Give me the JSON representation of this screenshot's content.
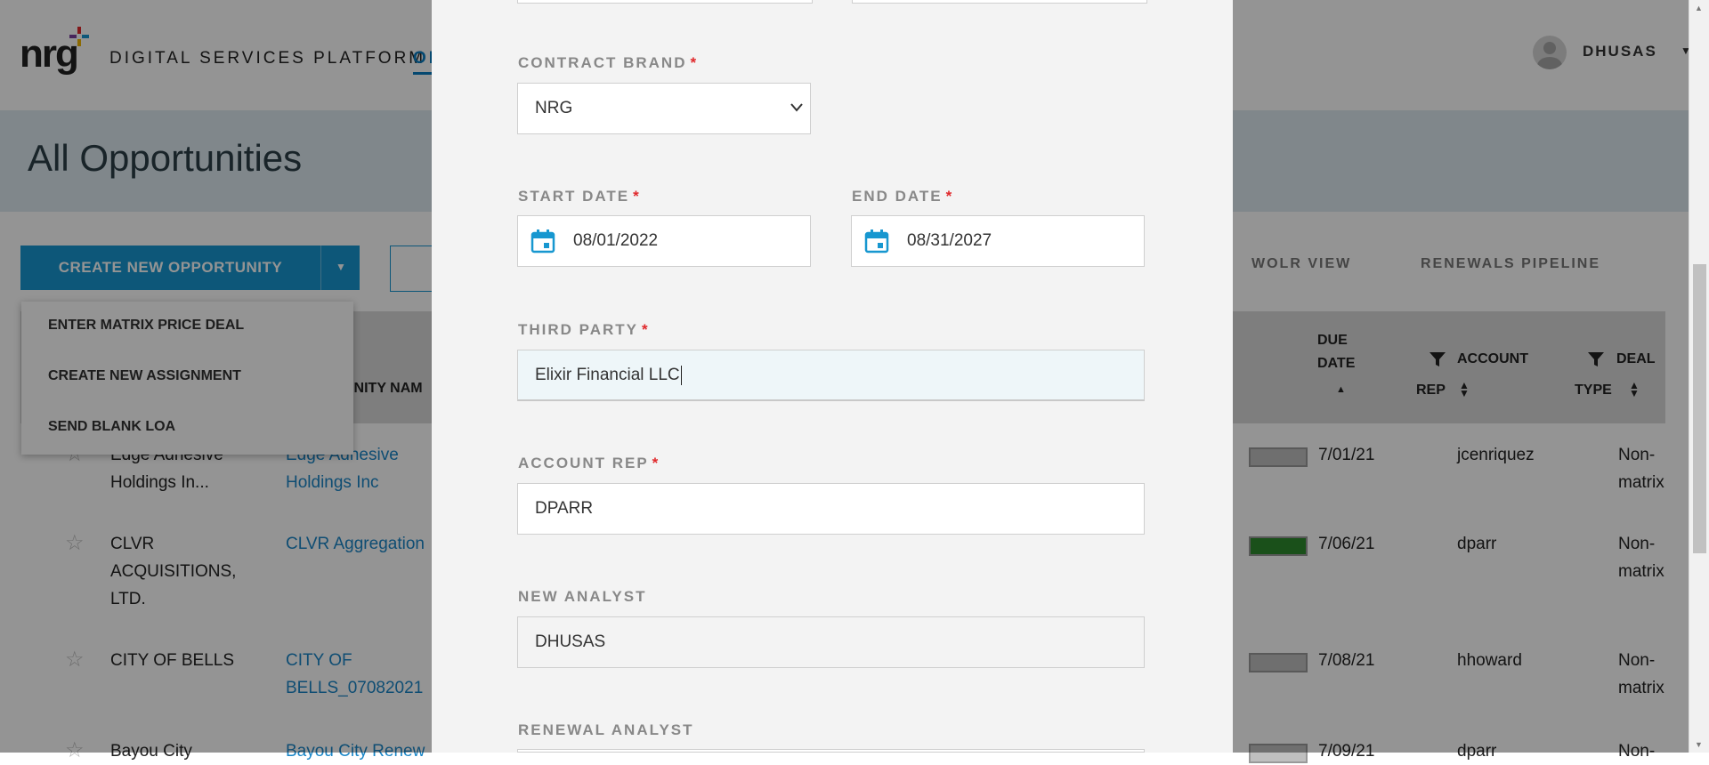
{
  "header": {
    "logo_text": "nrg",
    "platform_title": "DIGITAL SERVICES PLATFORM",
    "nav_tab_partial": "OP",
    "user_name": "DHUSAS"
  },
  "banner": {
    "title": "All Opportunities"
  },
  "toolbar": {
    "create_label": "CREATE NEW OPPORTUNITY",
    "view_tabs": [
      "WOLR VIEW",
      "RENEWALS PIPELINE"
    ]
  },
  "dropdown": {
    "items": [
      "ENTER MATRIX PRICE DEAL",
      "CREATE NEW ASSIGNMENT",
      "SEND BLANK LOA"
    ]
  },
  "table": {
    "headers": {
      "opp_name_partial": "UNITY NAM",
      "due_date_line1": "DUE",
      "due_date_line2": "DATE",
      "account_rep_line1": "ACCOUNT",
      "account_rep_line2": "REP",
      "deal_type_line1": "DEAL",
      "deal_type_line2": "TYPE"
    },
    "rows": [
      {
        "customer": "Edge Adhesive Holdings In...",
        "customer_l1": "Edge Adhesive",
        "customer_l2": "Holdings In...",
        "opp_l1": "Edge Adhesive",
        "opp_l2": "Holdings Inc",
        "opp_l3": "",
        "due": "7/01/21",
        "rep": "jcenriquez",
        "type_l1": "Non-",
        "type_l2": "matrix"
      },
      {
        "customer_l1": "CLVR",
        "customer_l2": "ACQUISITIONS,",
        "customer_l3": "LTD.",
        "opp_l1": "CLVR Aggregation",
        "opp_l2": "",
        "due": "7/06/21",
        "rep": "dparr",
        "type_l1": "Non-",
        "type_l2": "matrix"
      },
      {
        "customer_l1": "CITY OF BELLS",
        "customer_l2": "",
        "opp_l1": "CITY OF",
        "opp_l2": "BELLS_07082021",
        "due": "7/08/21",
        "rep": "hhoward",
        "type_l1": "Non-",
        "type_l2": "matrix"
      },
      {
        "customer_l1": "Bayou City",
        "opp_l1": "Bayou City Renew",
        "due": "7/09/21",
        "rep": "dparr",
        "type_l1": "Non-"
      }
    ]
  },
  "modal": {
    "contract_brand": {
      "label": "CONTRACT BRAND",
      "value": "NRG"
    },
    "start_date": {
      "label": "START DATE",
      "value": "08/01/2022"
    },
    "end_date": {
      "label": "END DATE",
      "value": "08/31/2027"
    },
    "third_party": {
      "label": "THIRD PARTY",
      "value": "Elixir Financial LLC"
    },
    "account_rep": {
      "label": "ACCOUNT REP",
      "value": "DPARR"
    },
    "new_analyst": {
      "label": "NEW ANALYST",
      "value": "DHUSAS"
    },
    "renewal_analyst": {
      "label": "RENEWAL ANALYST"
    },
    "required_mark": "*"
  },
  "colors": {
    "accent": "#1797d0",
    "required": "#e0282b",
    "progress_green": "#2d8a2d"
  }
}
